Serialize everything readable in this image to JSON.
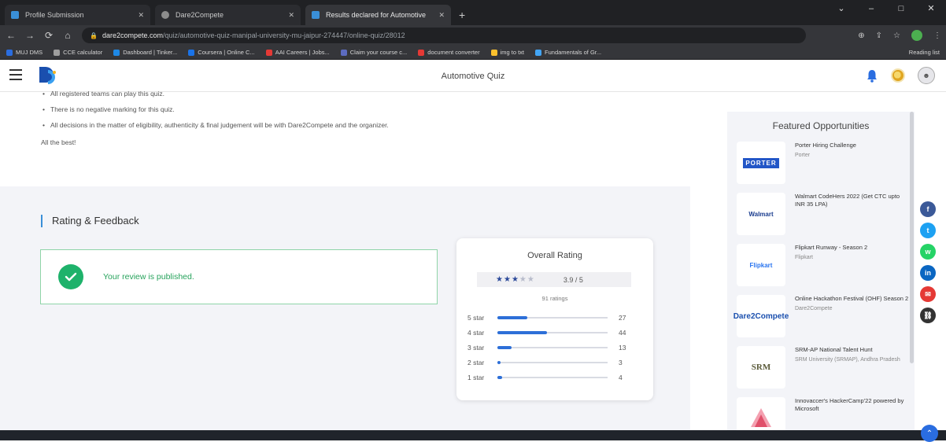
{
  "browser": {
    "tabs": [
      {
        "label": "Profile Submission",
        "active": false
      },
      {
        "label": "Dare2Compete",
        "active": false
      },
      {
        "label": "Results declared for Automotive",
        "active": true
      }
    ],
    "new_tab": "+",
    "window_controls": [
      "⌄",
      "–",
      "□",
      "✕"
    ],
    "url_host": "dare2compete.com",
    "url_path": "/quiz/automotive-quiz-manipal-university-mu-jaipur-274447/online-quiz/28012",
    "bookmarks": [
      {
        "label": "MUJ DMS",
        "color": "#2a6de0"
      },
      {
        "label": "CCE calculator",
        "color": "#9e9e9e"
      },
      {
        "label": "Dashboard | Tinker...",
        "color": "#1e88e5"
      },
      {
        "label": "Coursera | Online C...",
        "color": "#1a73e8"
      },
      {
        "label": "AAI Careers | Jobs...",
        "color": "#e53935"
      },
      {
        "label": "Claim your course c...",
        "color": "#5c6bc0"
      },
      {
        "label": "document converter",
        "color": "#e53935"
      },
      {
        "label": "img to txt",
        "color": "#fbc02d"
      },
      {
        "label": "Fundamentals of Gr...",
        "color": "#42a5f5"
      }
    ],
    "reading_list": "Reading list"
  },
  "header": {
    "title": "Automotive Quiz",
    "logo_text": "D2C"
  },
  "rules": {
    "items": [
      "All registered teams can play this quiz.",
      "There is no negative marking for this quiz.",
      "All decisions in the matter of eligibility, authenticity & final judgement will be with Dare2Compete and the organizer."
    ],
    "closing": "All the best!"
  },
  "rating_feedback": {
    "title": "Rating & Feedback",
    "review_message": "Your review is published."
  },
  "overall_rating": {
    "title": "Overall Rating",
    "stars_filled": 3,
    "stars_total": 5,
    "score": "3.9 / 5",
    "count_label": "91 ratings",
    "distribution": [
      {
        "label": "5 star",
        "count": "27",
        "fraction": 0.27
      },
      {
        "label": "4 star",
        "count": "44",
        "fraction": 0.45
      },
      {
        "label": "3 star",
        "count": "13",
        "fraction": 0.13
      },
      {
        "label": "2 star",
        "count": "3",
        "fraction": 0.03
      },
      {
        "label": "1 star",
        "count": "4",
        "fraction": 0.04
      }
    ]
  },
  "featured": {
    "title": "Featured Opportunities",
    "items": [
      {
        "logo": "PORTER",
        "title": "Porter Hiring Challenge",
        "org": "Porter"
      },
      {
        "logo": "Walmart",
        "title": "Walmart CodeHers 2022 (Get CTC upto INR 35 LPA)",
        "org": ""
      },
      {
        "logo": "Flipkart",
        "title": "Flipkart Runway - Season 2",
        "org": "Flipkart"
      },
      {
        "logo": "Dare2Compete",
        "title": "Online Hackathon Festival (OHF) Season 2",
        "org": "Dare2Compete"
      },
      {
        "logo": "SRM",
        "title": "SRM-AP National Talent Hunt",
        "org": "SRM University (SRMAP), Andhra Pradesh"
      },
      {
        "logo": "",
        "title": "Innovaccer's HackerCamp'22 powered by Microsoft",
        "org": ""
      }
    ]
  },
  "social": [
    {
      "name": "facebook",
      "glyph": "f",
      "color": "#3b5998"
    },
    {
      "name": "twitter",
      "glyph": "t",
      "color": "#1da1f2"
    },
    {
      "name": "whatsapp",
      "glyph": "w",
      "color": "#25d366"
    },
    {
      "name": "linkedin",
      "glyph": "in",
      "color": "#0a66c2"
    },
    {
      "name": "email",
      "glyph": "✉",
      "color": "#e53935"
    },
    {
      "name": "copy-link",
      "glyph": "⛓",
      "color": "#333333"
    }
  ]
}
